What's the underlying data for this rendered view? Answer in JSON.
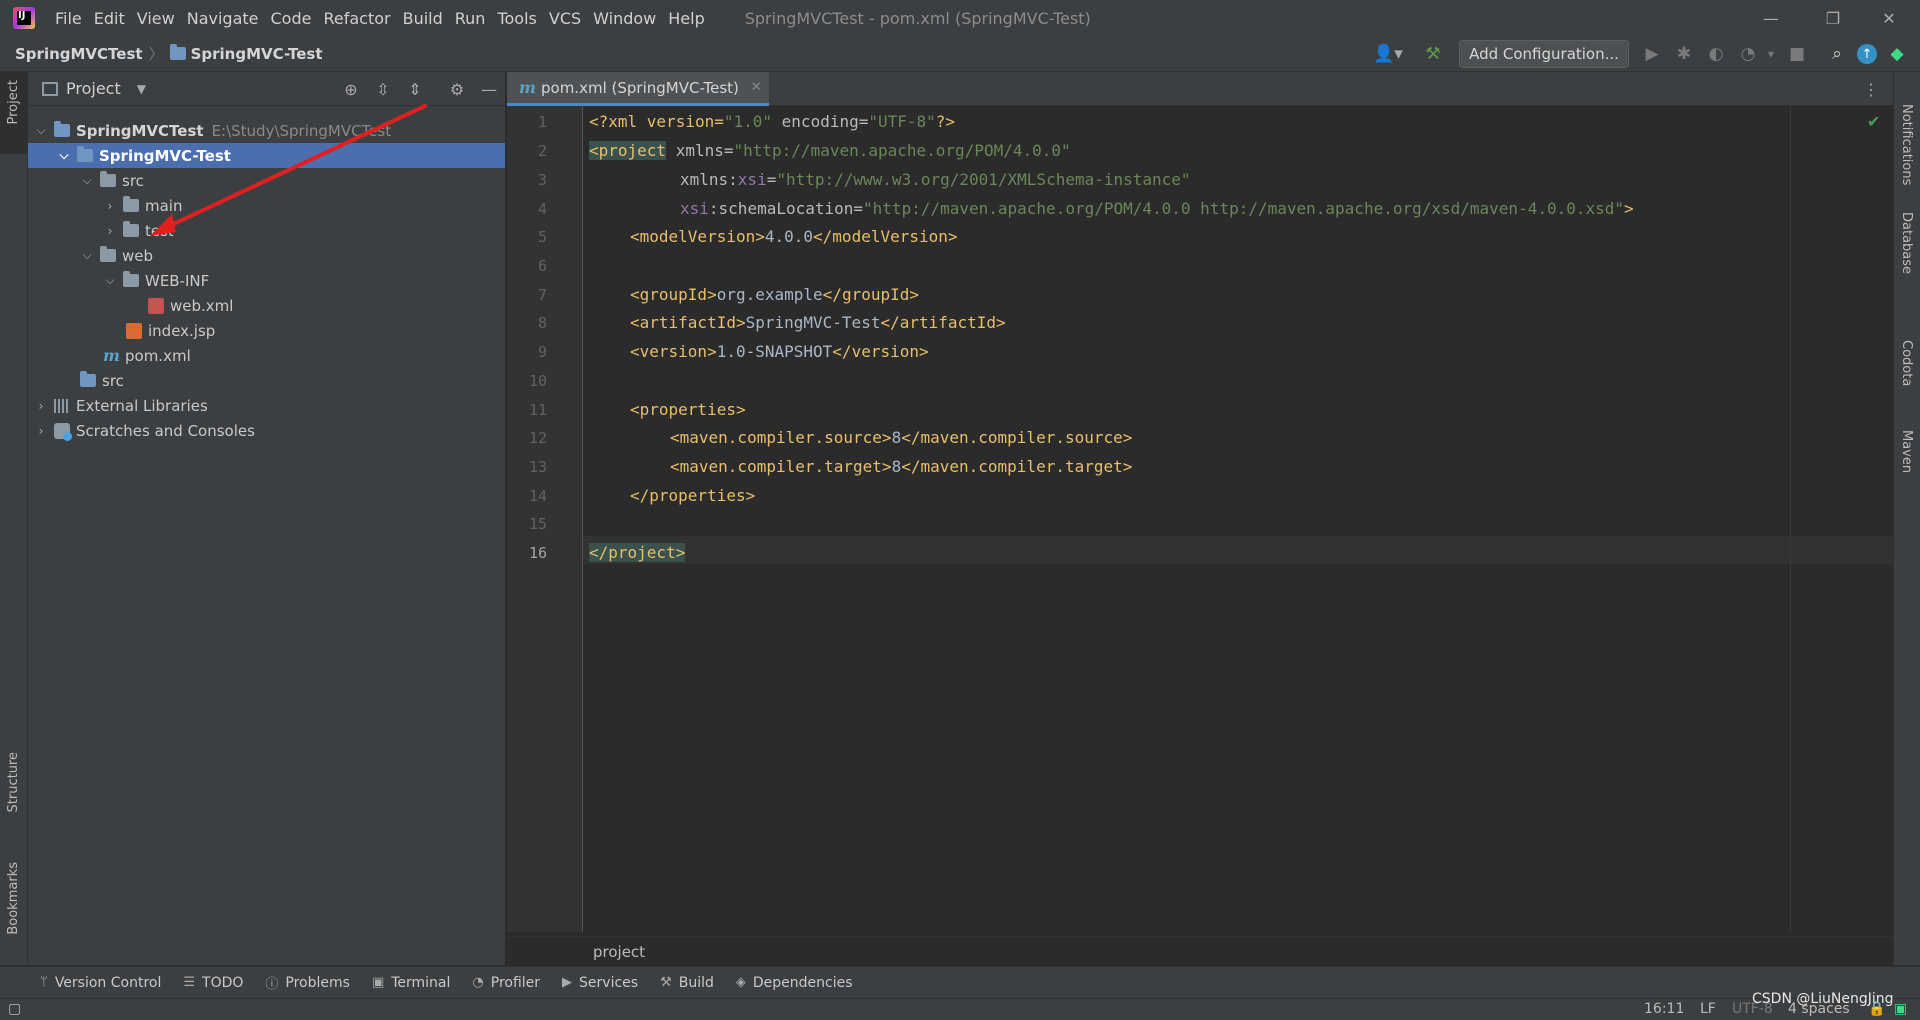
{
  "menubar": {
    "items": [
      "File",
      "Edit",
      "View",
      "Navigate",
      "Code",
      "Refactor",
      "Build",
      "Run",
      "Tools",
      "VCS",
      "Window",
      "Help"
    ],
    "window_title": "SpringMVCTest - pom.xml (SpringMVC-Test)"
  },
  "navbar": {
    "project": "SpringMVCTest",
    "module": "SpringMVC-Test",
    "add_config": "Add Configuration..."
  },
  "left_strip": {
    "project": "Project",
    "structure": "Structure",
    "bookmarks": "Bookmarks"
  },
  "project_panel": {
    "title": "Project",
    "root_name": "SpringMVCTest",
    "root_path": "E:\\Study\\SpringMVCTest",
    "module": "SpringMVC-Test",
    "src": "src",
    "main": "main",
    "test": "test",
    "web": "web",
    "web_inf": "WEB-INF",
    "web_xml": "web.xml",
    "index_jsp": "index.jsp",
    "pom_xml": "pom.xml",
    "root_src": "src",
    "external_libraries": "External Libraries",
    "scratches": "Scratches and Consoles"
  },
  "editor": {
    "tab_label": "pom.xml (SpringMVC-Test)",
    "line_numbers": [
      "1",
      "2",
      "3",
      "4",
      "5",
      "6",
      "7",
      "8",
      "9",
      "10",
      "11",
      "12",
      "13",
      "14",
      "15",
      "16"
    ],
    "breadcrumb": "project",
    "l1": {
      "open": "<?xml version=",
      "v1": "\"1.0\"",
      "mid": " encoding=",
      "v2": "\"UTF-8\"",
      "close": "?>"
    },
    "l2": {
      "tag": "<project",
      "attr": " xmlns=",
      "val": "\"http://maven.apache.org/POM/4.0.0\""
    },
    "l3": {
      "a": "xmlns:",
      "ns": "xsi",
      "eq": "=",
      "val": "\"http://www.w3.org/2001/XMLSchema-instance\""
    },
    "l4": {
      "ns": "xsi",
      "a": ":schemaLocation=",
      "val": "\"http://maven.apache.org/POM/4.0.0 http://maven.apache.org/xsd/maven-4.0.0.xsd\"",
      "close": ">"
    },
    "l5": {
      "open": "<modelVersion>",
      "text": "4.0.0",
      "close": "</modelVersion>"
    },
    "l7": {
      "open": "<groupId>",
      "text": "org.example",
      "close": "</groupId>"
    },
    "l8": {
      "open": "<artifactId>",
      "text": "SpringMVC-Test",
      "close": "</artifactId>"
    },
    "l9": {
      "open": "<version>",
      "text": "1.0-SNAPSHOT",
      "close": "</version>"
    },
    "l11": {
      "open": "<properties>"
    },
    "l12": {
      "open": "<maven.compiler.source>",
      "text": "8",
      "close": "</maven.compiler.source>"
    },
    "l13": {
      "open": "<maven.compiler.target>",
      "text": "8",
      "close": "</maven.compiler.target>"
    },
    "l14": {
      "close": "</properties>"
    },
    "l16": {
      "close": "</project>"
    }
  },
  "right_strip": {
    "notifications": "Notifications",
    "database": "Database",
    "codota": "Codota",
    "maven": "Maven"
  },
  "bottom_tools": [
    "Version Control",
    "TODO",
    "Problems",
    "Terminal",
    "Profiler",
    "Services",
    "Build",
    "Dependencies"
  ],
  "status": {
    "position": "16:11",
    "line_sep": "LF",
    "encoding": "UTF-8",
    "indent": "4 spaces",
    "watermark": "CSDN @LiuNengJing"
  },
  "colors": {
    "selection": "#4b6eaf",
    "annotation_arrow": "#e02020"
  }
}
